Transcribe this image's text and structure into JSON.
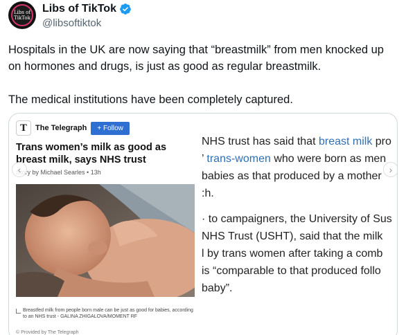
{
  "author": {
    "display_name": "Libs of TikTok",
    "handle": "@libsoftiktok",
    "avatar_text": "Libs of TikTok",
    "verified_icon": "verified-badge-icon",
    "verified_color": "#1d9bf0"
  },
  "tweet": {
    "paragraphs": [
      "Hospitals in the UK are now saying that “breastmilk” from men knocked up on hormones and drugs, is just as good as regular breastmilk.",
      "The medical institutions have been completely captured."
    ]
  },
  "article": {
    "publisher_logo_text": "T",
    "publisher": "The Telegraph",
    "follow_label": "+ Follow",
    "follow_color": "#2f6fd1",
    "title": "Trans women’s milk as good as breast milk, says NHS trust",
    "byline": "Story by Michael Searles • 13h",
    "caption": "Breastfed milk from people born male can be just as good for babies, according to an NHS trust - GALINA ZHIGALOVA/MOMENT RF",
    "provided_by": "© Provided by The Telegraph",
    "body_lines": [
      {
        "pre": "NHS trust has said that ",
        "link": "breast milk",
        "post": " pro"
      },
      {
        "pre": "’ ",
        "link": "trans-women",
        "post": " who were born as men"
      },
      {
        "pre": "babies as that produced by a mother",
        "link": "",
        "post": ""
      },
      {
        "pre": ":h.",
        "link": "",
        "post": ""
      }
    ],
    "body_lines_2": [
      "· to campaigners, the University of Sus",
      "NHS Trust (USHT), said that the milk",
      "l by trans women after taking a comb",
      "is “comparable to that produced follo",
      "baby”."
    ],
    "link_color": "#2f6fb6"
  }
}
